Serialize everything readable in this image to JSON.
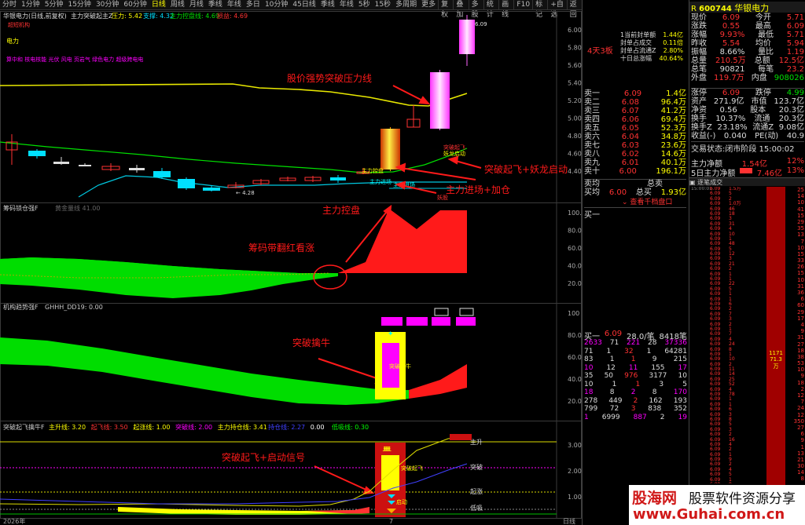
{
  "toolbar": {
    "periods": [
      "分时",
      "1分钟",
      "5分钟",
      "15分钟",
      "30分钟",
      "60分钟",
      "日线",
      "周线",
      "月线",
      "季线",
      "年线",
      "多日",
      "10分钟",
      "45日线",
      "季线",
      "年线",
      "5秒",
      "15秒",
      "多周期",
      "更多"
    ],
    "active_index": 6,
    "right_buttons": [
      "复权",
      "叠加",
      "多股",
      "统计",
      "画线",
      "F10",
      "标记",
      "+自选",
      "返回"
    ]
  },
  "main_panel": {
    "header": "华银电力(日线,前复权)",
    "indicator": "主力突破起主Z",
    "pressure_label": "压力:",
    "pressure": "5.42",
    "support_label": "支撑:",
    "support": "4.32",
    "control_label": "主力控盘线:",
    "control": "4.69",
    "loss_label": "损益:",
    "loss": "4.69",
    "sub_tag": "超短机构",
    "concept": "电力",
    "concept_tags": "算中和 核电核能 光伏 风电 页岩气 绿色电力 超级跨电电",
    "y_ticks": [
      "6.00",
      "5.80",
      "5.60",
      "5.40",
      "5.20",
      "5.00",
      "4.80",
      "4.60",
      "4.40"
    ],
    "high_label": "6.09",
    "low_label": "4.28",
    "annotations": {
      "breakout_pressure": "股价强势突破压力线",
      "breakout_fly": "突破起飞+妖龙启动",
      "main_entry": "主力进场+加仓",
      "control": "主力控盘",
      "small1": "主力控盘",
      "small2": "主力进场",
      "small3": "突破起飞",
      "small4": "妖龙启动",
      "small5": "妖股"
    }
  },
  "panel2": {
    "title": "筹码锁仓强F",
    "subtitle": "黄金量线 41.00",
    "y_ticks": [
      "100.0",
      "80.0",
      "60.0",
      "40.0",
      "20.0"
    ],
    "annotation": "筹码带翻红看涨"
  },
  "panel3": {
    "title": "机构趋势强F",
    "subtitle": "GHHH_DD19: 0.00",
    "y_ticks": [
      "100",
      "80.0",
      "60.0",
      "40.0",
      "20.0"
    ],
    "annotation": "突破擒牛",
    "small": "突破擒牛"
  },
  "panel4": {
    "title": "突破起飞擒牛F",
    "items": [
      {
        "k": "主升线",
        "v": "3.20",
        "c": "#ffff00"
      },
      {
        "k": "起飞线",
        "v": "3.50",
        "c": "#ff3232"
      },
      {
        "k": "起涨线",
        "v": "1.00",
        "c": "#ffff00"
      },
      {
        "k": "突破线",
        "v": "2.00",
        "c": "#ff00ff"
      },
      {
        "k": "主力持仓线",
        "v": "3.41",
        "c": "#ffff00"
      },
      {
        "k": "持仓线",
        "v": "2.27",
        "c": "#4040ff"
      },
      {
        "k": "",
        "v": "0.00",
        "c": "#fff"
      },
      {
        "k": "低吸线",
        "v": "0.30",
        "c": "#00ff00"
      }
    ],
    "y_ticks": [
      "3.00",
      "2.00",
      "1.00"
    ],
    "right_labels": [
      "主升",
      "突破",
      "起涨",
      "低吸"
    ],
    "annotation": "突破起飞+启动信号",
    "small1": "突破起飞",
    "small2": "启动"
  },
  "date_bar": {
    "left": "2026年",
    "mark": "7",
    "right": "日线"
  },
  "mid": {
    "badge": "4天3板",
    "seal": [
      [
        "1当前封单额",
        "1.44亿"
      ],
      [
        "封单占成交",
        "0.11倍"
      ],
      [
        "封单占流通Z",
        "2.80%"
      ],
      [
        "十日总涨幅",
        "40.64%"
      ]
    ],
    "sell_rows": [
      [
        "卖一",
        "6.09",
        "1.4亿"
      ],
      [
        "卖二",
        "6.08",
        "96.4万"
      ],
      [
        "卖三",
        "6.07",
        "41.2万"
      ],
      [
        "卖四",
        "6.06",
        "69.4万"
      ],
      [
        "卖五",
        "6.05",
        "52.3万"
      ],
      [
        "卖六",
        "6.04",
        "34.8万"
      ],
      [
        "卖七",
        "6.03",
        "23.6万"
      ],
      [
        "卖八",
        "6.02",
        "14.6万"
      ],
      [
        "卖九",
        "6.01",
        "40.1万"
      ],
      [
        "卖十",
        "6.00",
        "196.1万"
      ]
    ],
    "avg_sell": [
      "卖均",
      "总卖",
      ""
    ],
    "avg_buy": [
      "买均",
      "6.00",
      "总买",
      "1.93亿"
    ],
    "link": "查看千档盘口",
    "buy_header": "买一",
    "tick_header": [
      "买一",
      "6.09",
      "28.0/笔",
      "8418笔"
    ],
    "ticks": [
      [
        "2633",
        "71",
        "221",
        "28",
        "37336"
      ],
      [
        "71",
        "1",
        "32",
        "1",
        "64281"
      ],
      [
        "83",
        "1",
        "1",
        "9",
        "215"
      ],
      [
        "10",
        "12",
        "11",
        "155",
        "17"
      ],
      [
        "35",
        "50",
        "976",
        "3177",
        "10"
      ],
      [
        "10",
        "1",
        "1",
        "3",
        "5"
      ],
      [
        "18",
        "8",
        "2",
        "8",
        "170"
      ],
      [
        "278",
        "449",
        "2",
        "162",
        "193"
      ],
      [
        "799",
        "72",
        "3",
        "838",
        "352"
      ],
      [
        "1",
        "6999",
        "887",
        "2",
        "19"
      ]
    ]
  },
  "right": {
    "code": "600744",
    "name": "华银电力",
    "quote": [
      [
        "现价",
        "6.09",
        "今开",
        "5.71"
      ],
      [
        "涨跌",
        "0.55",
        "最高",
        "6.09"
      ],
      [
        "涨幅",
        "9.93%",
        "最低",
        "5.71"
      ],
      [
        "昨收",
        "5.54",
        "均价",
        "5.94"
      ],
      [
        "振幅",
        "8.66%",
        "量比",
        "1.19"
      ],
      [
        "总量",
        "210.5万",
        "总额",
        "12.5亿"
      ],
      [
        "总笔",
        "90821",
        "每笔",
        "23.2"
      ],
      [
        "外盘",
        "119.7万",
        "内盘",
        "908026"
      ]
    ],
    "quote2": [
      [
        "涨停",
        "6.09",
        "跌停",
        "4.99"
      ],
      [
        "资产",
        "271.9亿",
        "市值",
        "123.7亿"
      ],
      [
        "净资",
        "0.56",
        "股本",
        "20.3亿"
      ],
      [
        "换手",
        "10.37%",
        "流通",
        "20.3亿"
      ],
      [
        "换手Z",
        "23.18%",
        "流通Z",
        "9.08亿"
      ],
      [
        "收益(-)",
        "0.040",
        "PE(动)",
        "40.9"
      ]
    ],
    "status": "交易状态:闭市阶段 15:00:02",
    "net": [
      "主力净额",
      "1.54亿",
      "12%"
    ],
    "net5": [
      "5日主力净额",
      "7.46亿",
      "13%"
    ],
    "tx_title": "逐笔成交",
    "tx_time": "15:00:01",
    "tx_price": "6.09",
    "tx_vols": [
      "1.5万",
      "5",
      "2",
      "1.0万",
      "46",
      "18",
      "3",
      "31",
      "4",
      "10",
      "1",
      "48",
      "5",
      "12",
      "3",
      "21",
      "2",
      "1",
      "1",
      "22",
      "5",
      "1",
      "1",
      "6",
      "2",
      "7",
      "3",
      "2",
      "1",
      "7",
      "4",
      "24",
      "8",
      "1",
      "10",
      "2",
      "11",
      "14",
      "25",
      "52",
      "4",
      "78",
      "1",
      "1",
      "6",
      "3",
      "8",
      "5",
      "3",
      "2",
      "16",
      "4",
      "2",
      "1",
      "9",
      "2",
      "4",
      "5",
      "1",
      "8",
      "7",
      "3",
      "2"
    ],
    "bar_label": "1171",
    "bar_sub": "71.3万",
    "right_nums": [
      "25",
      "14",
      "10",
      "41",
      "15",
      "29",
      "35",
      "13",
      "7",
      "10",
      "15",
      "33",
      "26",
      "15",
      "10",
      "31",
      "36",
      "6",
      "60",
      "29",
      "17",
      "4",
      "9",
      "31",
      "27",
      "18",
      "38",
      "53",
      "10",
      "9",
      "18",
      "2",
      "12",
      "7",
      "24",
      "12",
      "350",
      "27",
      "6",
      "9",
      "1",
      "13",
      "21",
      "30",
      "14",
      "8"
    ]
  },
  "watermark": {
    "brand": "股海网",
    "slogan": "股票软件资源分享",
    "url": "www.Guhai.com.cn"
  }
}
